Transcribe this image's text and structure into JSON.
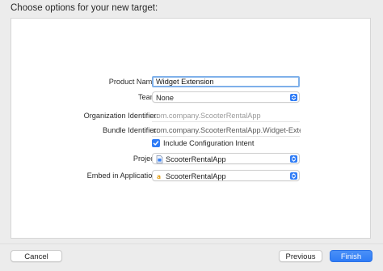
{
  "window": {
    "title": "Choose options for your new target:"
  },
  "form": {
    "product_name": {
      "label": "Product Name:",
      "value": "Widget Extension"
    },
    "team": {
      "label": "Team:",
      "value": "None"
    },
    "organization_identifier": {
      "label": "Organization Identifier:",
      "value": "com.company.ScooterRentalApp"
    },
    "bundle_identifier": {
      "label": "Bundle Identifier:",
      "value": "com.company.ScooterRentalApp.Widget-Extens..."
    },
    "include_configuration_intent": {
      "label": "Include Configuration Intent",
      "checked": true
    },
    "project": {
      "label": "Project:",
      "value": "ScooterRentalApp",
      "icon": "project-file-icon"
    },
    "embed_in_application": {
      "label": "Embed in Application:",
      "value": "ScooterRentalApp",
      "icon": "app-icon"
    }
  },
  "buttons": {
    "cancel": "Cancel",
    "previous": "Previous",
    "finish": "Finish"
  },
  "colors": {
    "accent": "#2f7cf6",
    "focus_ring": "#7fb0ea",
    "background": "#ececec",
    "panel": "#ffffff"
  }
}
